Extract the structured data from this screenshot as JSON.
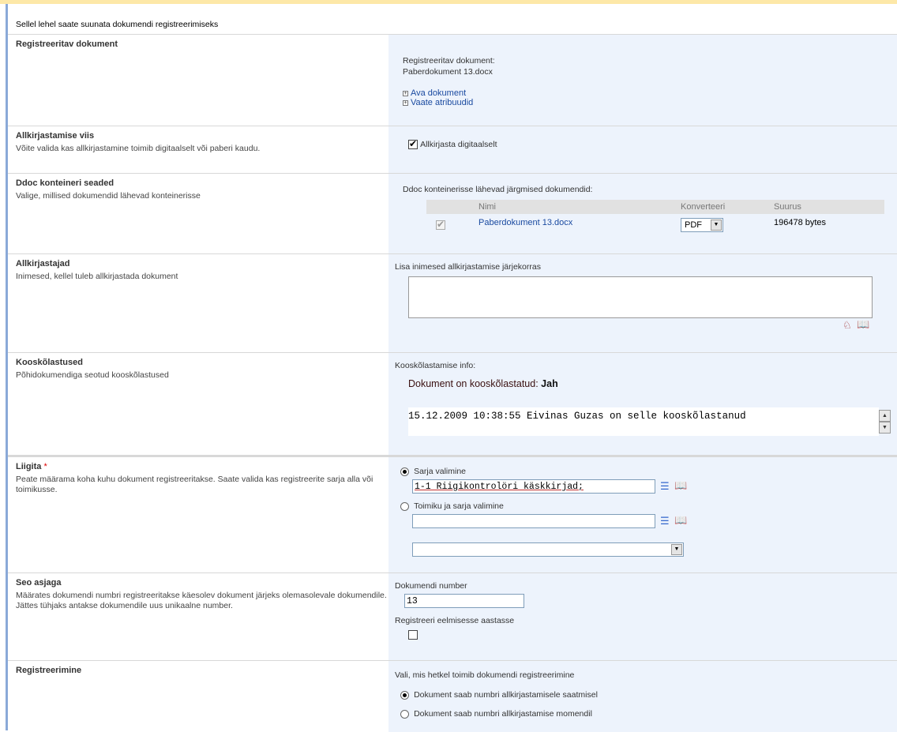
{
  "intro": "Sellel lehel saate suunata dokumendi registreerimiseks",
  "registered_doc": {
    "title": "Registreeritav dokument",
    "label": "Registreeritav dokument:",
    "filename": "Paberdokument 13.docx",
    "open_link": "Ava dokument",
    "attributes_link": "Vaate atribuudid"
  },
  "signing_method": {
    "title": "Allkirjastamise viis",
    "desc": "Võite valida kas allkirjastamine toimib digitaalselt või paberi kaudu.",
    "checkbox_label": "Allkirjasta digitaalselt"
  },
  "ddoc": {
    "title": "Ddoc konteineri seaded",
    "desc": "Valige, millised dokumendid lähevad konteinerisse",
    "label": "Ddoc konteinerisse lähevad järgmised dokumendid:",
    "columns": {
      "name": "Nimi",
      "convert": "Konverteeri",
      "size": "Suurus"
    },
    "rows": [
      {
        "name": "Paberdokument 13.docx",
        "convert": "PDF",
        "size": "196478 bytes"
      }
    ]
  },
  "signers": {
    "title": "Allkirjastajad",
    "desc": "Inimesed, kellel tuleb allkirjastada dokument",
    "label": "Lisa inimesed allkirjastamise järjekorras",
    "value": ""
  },
  "approvals": {
    "title": "Kooskõlastused",
    "desc": "Põhidokumendiga seotud kooskõlastused",
    "label": "Kooskõlastamise info:",
    "status_label": "Dokument on kooskõlastatud:",
    "status_value": "Jah",
    "entry": "15.12.2009 10:38:55 Eivinas Guzas on selle kooskõlastanud"
  },
  "attach": {
    "title": "Liigita",
    "required_mark": "*",
    "desc": "Peate määrama koha kuhu dokument registreeritakse. Saate valida kas registreerite sarja alla või toimikusse.",
    "option1_label": "Sarja valimine",
    "series_value": "1-1 Riigikontrolöri käskkirjad;",
    "option2_label": "Toimiku ja sarja valimine",
    "folder_value": "",
    "folder_select_value": ""
  },
  "link_case": {
    "title": "Seo asjaga",
    "desc": "Määrates dokumendi numbri registreeritakse käesolev dokument järjeks olemasolevale dokumendile. Jättes tühjaks antakse dokumendile uus unikaalne number.",
    "number_label": "Dokumendi number",
    "number_value": "13",
    "prev_year_label": "Registreeri eelmisesse aastasse"
  },
  "registration": {
    "title": "Registreerimine",
    "label": "Vali, mis hetkel toimib dokumendi registreerimine",
    "option1_label": "Dokument saab numbri allkirjastamisele saatmisel",
    "option2_label": "Dokument saab numbri allkirjastamise momendil"
  }
}
